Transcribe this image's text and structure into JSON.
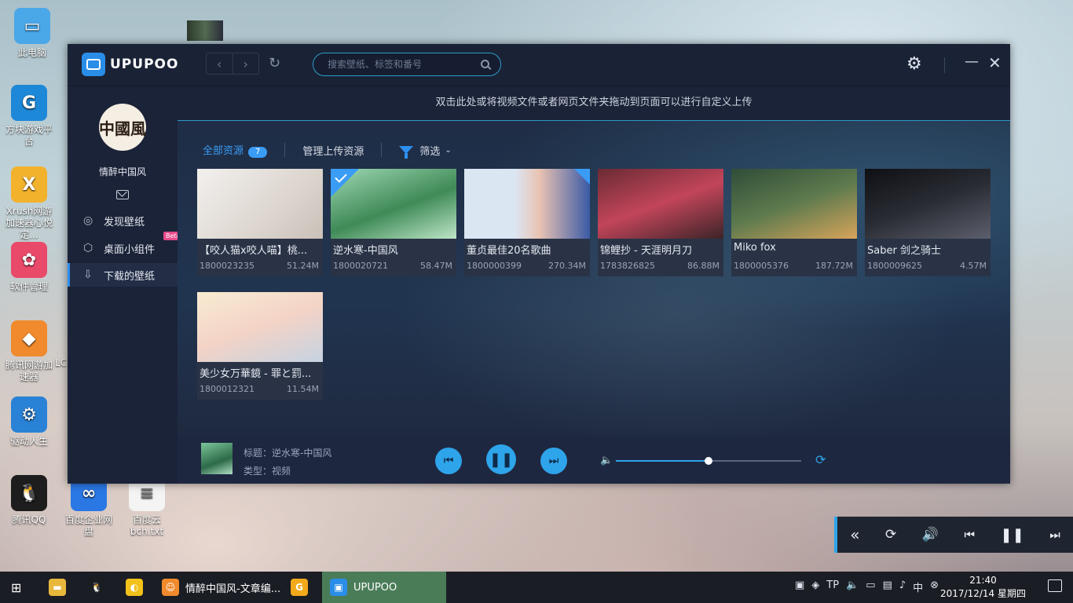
{
  "desktop": {
    "icons": [
      {
        "name": "desktop-icon-this-pc",
        "label": "此电脑",
        "glyph": "▭",
        "color": "#4aa7e8"
      },
      {
        "name": "desktop-icon-fangkuai",
        "label": "方块游戏平台",
        "glyph": "G",
        "color": "#1e88d8"
      },
      {
        "name": "desktop-icon-xrush",
        "label": "Xrush网游加速器心悦定...",
        "glyph": "X",
        "color": "#f2b22c"
      },
      {
        "name": "desktop-icon-software",
        "label": "软件管理",
        "glyph": "✿",
        "color": "#e94a6a"
      },
      {
        "name": "desktop-icon-tencent-acc",
        "label": "腾讯网游加速器",
        "glyph": "◆",
        "color": "#f08a2c"
      },
      {
        "name": "desktop-icon-driver",
        "label": "驱动人生",
        "glyph": "⚙",
        "color": "#2a82d6"
      },
      {
        "name": "desktop-icon-qq",
        "label": "腾讯QQ",
        "glyph": "🐧",
        "color": "#1d1d1d"
      },
      {
        "name": "desktop-icon-baidu-pan",
        "label": "百度企业网盘",
        "glyph": "∞",
        "color": "#2a78e4"
      },
      {
        "name": "desktop-icon-txt",
        "label": "百度云bch.txt",
        "glyph": "≡",
        "color": "#f4f4f4"
      }
    ],
    "partial_label": "LC"
  },
  "app": {
    "brand": "UPUPOO",
    "search_placeholder": "搜索壁纸、标签和番号",
    "upload_hint": "双击此处或将视频文件或者网页文件夹拖动到页面可以进行自定义上传",
    "user": {
      "name": "情醉中国风",
      "avatar_text": "中國風"
    },
    "sidebar": [
      {
        "label": "发现壁纸",
        "icon": "planet-icon"
      },
      {
        "label": "桌面小组件",
        "icon": "widget-icon",
        "badge": "Beta"
      },
      {
        "label": "下载的壁纸",
        "icon": "download-icon",
        "active": true
      }
    ],
    "tabs": {
      "all": "全部资源",
      "count": "7",
      "manage": "管理上传资源",
      "filter": "筛选"
    },
    "cards": [
      {
        "title": "【咬人猫x咬人喵】桃...",
        "id": "1800023235",
        "size": "51.24M",
        "bg": "linear-gradient(135deg,#f2f0ee,#ddd6cf 60%,#c9c0b8)"
      },
      {
        "title": "逆水寒-中国风",
        "id": "1800020721",
        "size": "58.47M",
        "bg": "linear-gradient(160deg,#9fd8b4,#3f8a56 55%,#bde6c8)",
        "checked": true
      },
      {
        "title": "董贞最佳20名歌曲",
        "id": "1800000399",
        "size": "270.34M",
        "bg": "linear-gradient(90deg,#dbe6f3 0%,#dbe6f3 40%,#e9c2b2 60%,#3a5aa6 100%)",
        "corner": true
      },
      {
        "title": "锦鲤抄 - 天涯明月刀",
        "id": "1783826825",
        "size": "86.88M",
        "bg": "linear-gradient(160deg,#6a2b34,#c2455a 50%,#3c2428)"
      },
      {
        "title": "Miko fox",
        "id": "1800005376",
        "size": "187.72M",
        "bg": "linear-gradient(160deg,#2f4d38,#5e7a4e 50%,#d7a45a)"
      },
      {
        "title": "Saber 剑之骑士",
        "id": "1800009625",
        "size": "4.57M",
        "bg": "linear-gradient(160deg,#0f1014,#2a2c34 50%,#5c5f6c)"
      },
      {
        "title": "美少女万華鏡 - 罪と罰...",
        "id": "1800012321",
        "size": "11.54M",
        "bg": "linear-gradient(160deg,#f8ecd2,#f3d3c6 50%,#c6d3e2)"
      }
    ],
    "player": {
      "title": "标题：逆水寒-中国风",
      "type": "类型：视频",
      "volume": 0.5
    }
  },
  "taskbar": {
    "items": [
      {
        "name": "taskbar-file-explorer",
        "label": "",
        "color": "#e8b83c",
        "glyph": "▬"
      },
      {
        "name": "taskbar-qq",
        "label": "",
        "color": "#1b1d24",
        "glyph": "🐧"
      },
      {
        "name": "taskbar-browser",
        "label": "",
        "color": "#f2c21a",
        "glyph": "◐"
      },
      {
        "name": "taskbar-article-editor",
        "label": "情醉中国风-文章编...",
        "color": "#f08a2c",
        "glyph": "☺"
      },
      {
        "name": "taskbar-g-app",
        "label": "",
        "color": "#f2a91a",
        "glyph": "G"
      },
      {
        "name": "taskbar-upupoo",
        "label": "UPUPOO",
        "color": "#2a8de8",
        "glyph": "▣"
      }
    ],
    "time": "21:40",
    "date": "2017/12/14 星期四"
  }
}
